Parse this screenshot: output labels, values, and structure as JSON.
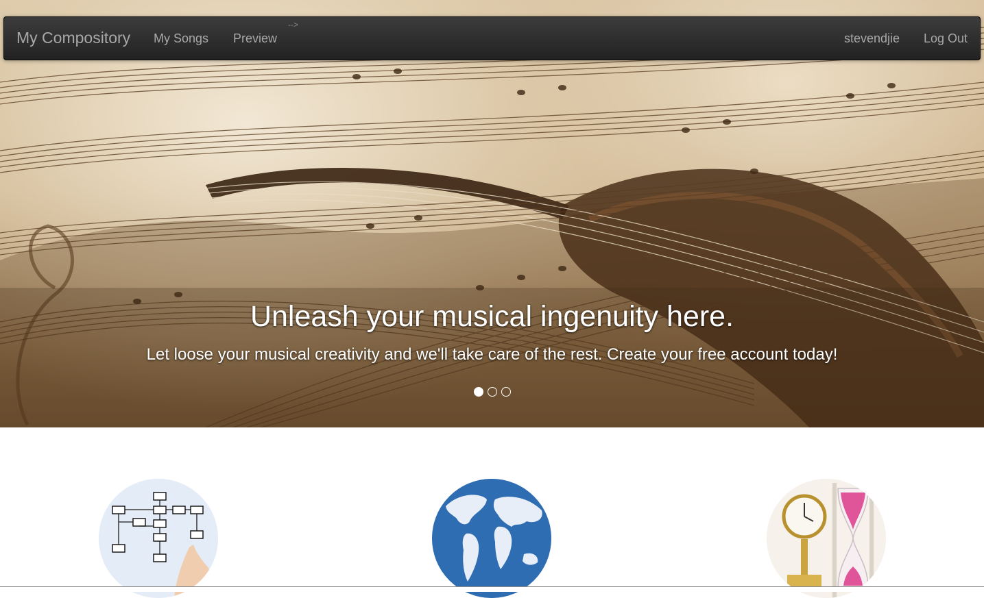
{
  "navbar": {
    "brand": "My Compository",
    "links": [
      "My Songs",
      "Preview"
    ],
    "stray_text": "-->",
    "username": "stevendjie",
    "logout": "Log Out"
  },
  "carousel": {
    "heading": "Unleash your musical ingenuity here.",
    "subheading": "Let loose your musical creativity and we'll take care of the rest. Create your free account today!",
    "slide_count": 3,
    "active_slide": 1
  },
  "features": {
    "icons": [
      "planning-flowchart-icon",
      "world-globe-icon",
      "clock-hourglass-icon"
    ]
  },
  "colors": {
    "navbar_bg": "#222222",
    "nav_text": "#a8a8a8",
    "hero_text": "#ffffff",
    "globe_blue": "#2f6db3",
    "hourglass_pink": "#e0559a"
  }
}
